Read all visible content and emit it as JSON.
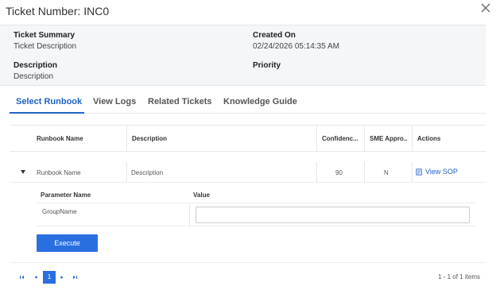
{
  "modal": {
    "title": "Ticket Number: INC0",
    "close_icon": "close-icon"
  },
  "summary": {
    "ticket_summary_label": "Ticket Summary",
    "ticket_summary_value": "Ticket Description",
    "created_on_label": "Created On",
    "created_on_value": "02/24/2026 05:14:35 AM",
    "description_label": "Description",
    "description_value": "Description",
    "priority_label": "Priority",
    "priority_value": ""
  },
  "tabs": [
    {
      "label": "Select Runbook",
      "active": true
    },
    {
      "label": "View Logs",
      "active": false
    },
    {
      "label": "Related Tickets",
      "active": false
    },
    {
      "label": "Knowledge Guide",
      "active": false
    }
  ],
  "grid": {
    "columns": [
      "Runbook Name",
      "Description",
      "Confidenc...",
      "SME Appro...",
      "Actions"
    ],
    "rows": [
      {
        "runbook_name": "Runbook Name",
        "description": "Description",
        "confidence": "90",
        "sme_approved": "N",
        "action_label": "View SOP",
        "action_icon": "document-icon",
        "expanded": true
      }
    ]
  },
  "parameters": {
    "columns": [
      "Parameter Name",
      "Value"
    ],
    "rows": [
      {
        "name": "GroupName",
        "value": ""
      }
    ]
  },
  "execute_label": "Execute",
  "pager": {
    "current_page": "1",
    "info": "1 - 1 of 1 items",
    "icons": [
      "first-page-icon",
      "prev-page-icon",
      "next-page-icon",
      "last-page-icon"
    ]
  },
  "colors": {
    "accent": "#1e63c7",
    "button": "#2a6fe0",
    "summary_bg": "#f5f6f8"
  }
}
